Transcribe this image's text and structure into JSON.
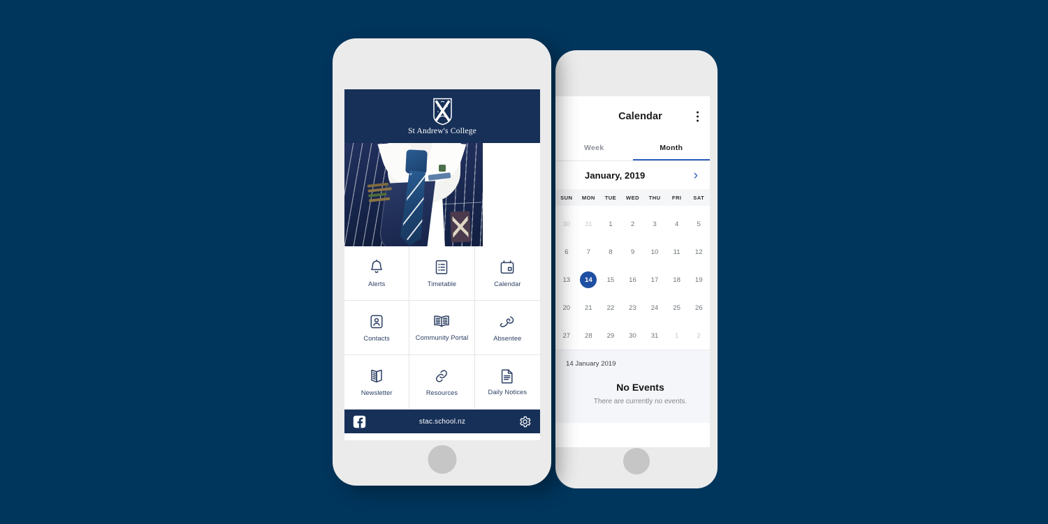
{
  "background_color": "#00355c",
  "brand": {
    "navy": "#173058",
    "accent_blue": "#2d5fbe",
    "selected_day_blue": "#1f4fa3",
    "icon_navy": "#2b3f63"
  },
  "front_phone": {
    "app_header": {
      "crest_icon": "st-andrews-crest-icon",
      "college_name": "St Andrew's College"
    },
    "hero_image_alt": "student-uniform-photo",
    "menu_tiles": [
      {
        "label": "Alerts",
        "icon": "bell-icon"
      },
      {
        "label": "Timetable",
        "icon": "list-document-icon"
      },
      {
        "label": "Calendar",
        "icon": "calendar-icon"
      },
      {
        "label": "Contacts",
        "icon": "contact-card-icon"
      },
      {
        "label": "Community Portal",
        "icon": "open-book-icon"
      },
      {
        "label": "Absentee",
        "icon": "phone-handset-icon"
      },
      {
        "label": "Newsletter",
        "icon": "newsletter-book-icon"
      },
      {
        "label": "Resources",
        "icon": "link-chain-icon"
      },
      {
        "label": "Daily Notices",
        "icon": "document-page-icon"
      }
    ],
    "footer": {
      "facebook_icon": "facebook-icon",
      "url": "stac.school.nz",
      "settings_icon": "gear-icon"
    }
  },
  "back_phone": {
    "topbar": {
      "title": "Calendar",
      "overflow_icon": "kebab-menu-icon"
    },
    "tabs": [
      {
        "label": "Week",
        "active": false
      },
      {
        "label": "Month",
        "active": true
      }
    ],
    "month_nav": {
      "label": "January, 2019",
      "next_icon": "chevron-right-icon"
    },
    "day_headers": [
      "SUN",
      "MON",
      "TUE",
      "WED",
      "THU",
      "FRI",
      "SAT"
    ],
    "weeks": [
      [
        {
          "n": "30",
          "state": "dim"
        },
        {
          "n": "31",
          "state": "dim"
        },
        {
          "n": "1",
          "state": "normal"
        },
        {
          "n": "2",
          "state": "normal"
        },
        {
          "n": "3",
          "state": "normal"
        },
        {
          "n": "4",
          "state": "normal"
        },
        {
          "n": "5",
          "state": "normal"
        }
      ],
      [
        {
          "n": "6",
          "state": "normal"
        },
        {
          "n": "7",
          "state": "normal"
        },
        {
          "n": "8",
          "state": "normal"
        },
        {
          "n": "9",
          "state": "normal"
        },
        {
          "n": "10",
          "state": "normal"
        },
        {
          "n": "11",
          "state": "normal"
        },
        {
          "n": "12",
          "state": "normal"
        }
      ],
      [
        {
          "n": "13",
          "state": "normal"
        },
        {
          "n": "14",
          "state": "selected"
        },
        {
          "n": "15",
          "state": "normal"
        },
        {
          "n": "16",
          "state": "normal"
        },
        {
          "n": "17",
          "state": "normal"
        },
        {
          "n": "18",
          "state": "normal"
        },
        {
          "n": "19",
          "state": "normal"
        }
      ],
      [
        {
          "n": "20",
          "state": "normal"
        },
        {
          "n": "21",
          "state": "normal"
        },
        {
          "n": "22",
          "state": "normal"
        },
        {
          "n": "23",
          "state": "normal"
        },
        {
          "n": "24",
          "state": "normal"
        },
        {
          "n": "25",
          "state": "normal"
        },
        {
          "n": "26",
          "state": "normal"
        }
      ],
      [
        {
          "n": "27",
          "state": "normal"
        },
        {
          "n": "28",
          "state": "normal"
        },
        {
          "n": "29",
          "state": "normal"
        },
        {
          "n": "30",
          "state": "normal"
        },
        {
          "n": "31",
          "state": "normal"
        },
        {
          "n": "1",
          "state": "dim"
        },
        {
          "n": "2",
          "state": "dim"
        }
      ]
    ],
    "events_panel": {
      "date": "14 January 2019",
      "empty_title": "No Events",
      "empty_subtitle": "There are currently no events."
    }
  }
}
